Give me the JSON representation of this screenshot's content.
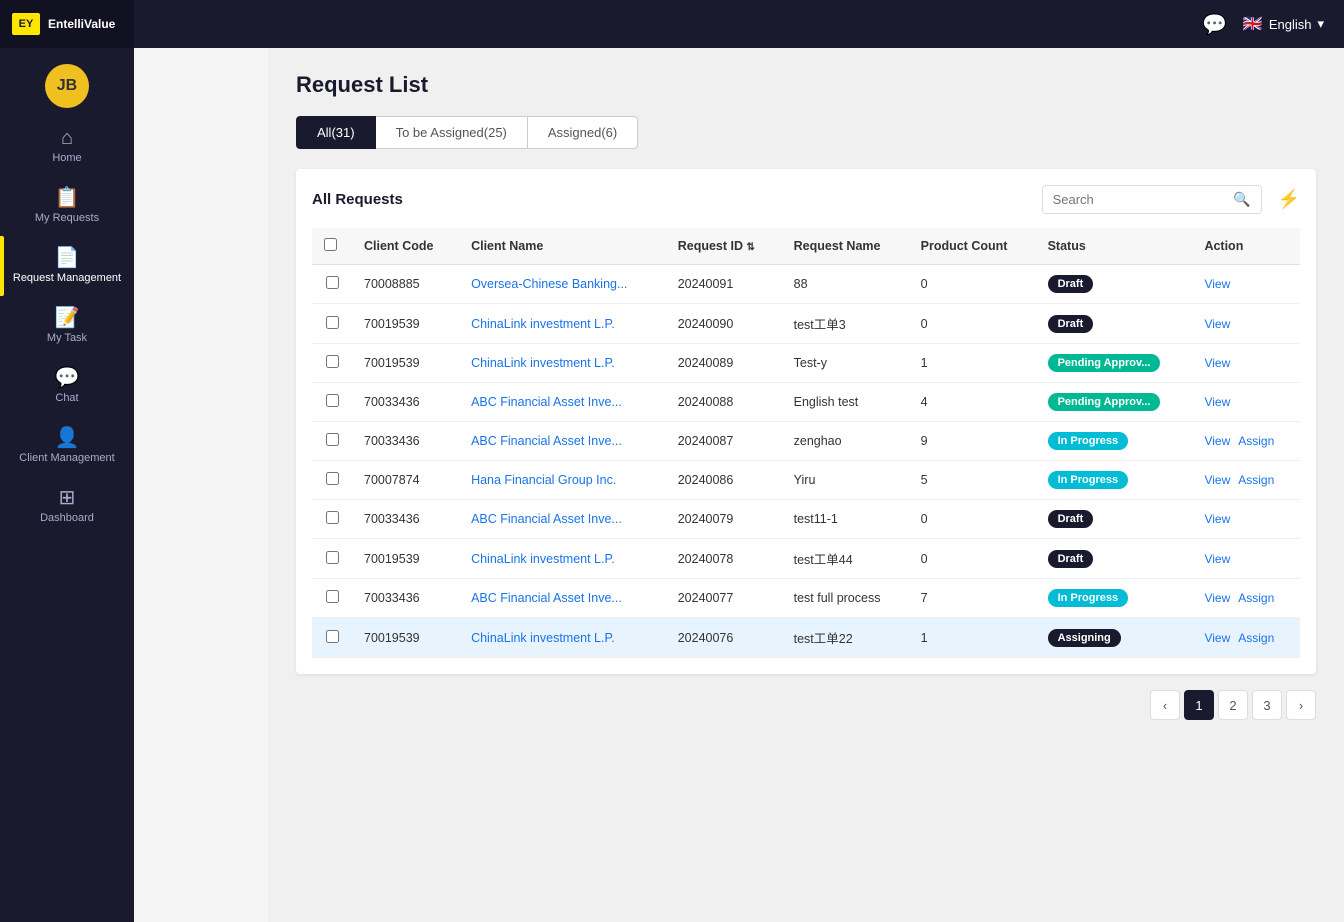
{
  "app": {
    "brand": "EntelliValue",
    "logo_text": "EY"
  },
  "topbar": {
    "language": "English",
    "language_icon": "🇬🇧"
  },
  "sidebar": {
    "avatar_initials": "JB",
    "nav_items": [
      {
        "id": "home",
        "label": "Home",
        "icon": "⌂",
        "active": false
      },
      {
        "id": "my-requests",
        "label": "My Requests",
        "icon": "📋",
        "active": false
      },
      {
        "id": "request-management",
        "label": "Request Management",
        "icon": "📄",
        "active": true
      },
      {
        "id": "my-task",
        "label": "My Task",
        "icon": "📝",
        "active": false
      },
      {
        "id": "chat",
        "label": "Chat",
        "icon": "💬",
        "active": false
      },
      {
        "id": "client-management",
        "label": "Client Management",
        "icon": "👤",
        "active": false
      },
      {
        "id": "dashboard",
        "label": "Dashboard",
        "icon": "⊞",
        "active": false
      }
    ]
  },
  "page": {
    "title": "Request List",
    "tabs": [
      {
        "id": "all",
        "label": "All(31)",
        "active": true
      },
      {
        "id": "to-be-assigned",
        "label": "To be Assigned(25)",
        "active": false
      },
      {
        "id": "assigned",
        "label": "Assigned(6)",
        "active": false
      }
    ],
    "section_title": "All Requests",
    "search_placeholder": "Search"
  },
  "table": {
    "columns": [
      {
        "id": "select",
        "label": ""
      },
      {
        "id": "client-code",
        "label": "Client Code"
      },
      {
        "id": "client-name",
        "label": "Client Name"
      },
      {
        "id": "request-id",
        "label": "Request ID"
      },
      {
        "id": "request-name",
        "label": "Request Name"
      },
      {
        "id": "product-count",
        "label": "Product Count"
      },
      {
        "id": "status",
        "label": "Status"
      },
      {
        "id": "action",
        "label": "Action"
      }
    ],
    "rows": [
      {
        "id": "row-1",
        "client_code": "70008885",
        "client_name": "Oversea-Chinese Banking...",
        "request_id": "20240091",
        "request_name": "88",
        "product_count": "0",
        "status": "Draft",
        "status_type": "draft",
        "actions": [
          "View"
        ],
        "highlighted": false
      },
      {
        "id": "row-2",
        "client_code": "70019539",
        "client_name": "ChinaLink investment L.P.",
        "request_id": "20240090",
        "request_name": "test工单3",
        "product_count": "0",
        "status": "Draft",
        "status_type": "draft",
        "actions": [
          "View"
        ],
        "highlighted": false
      },
      {
        "id": "row-3",
        "client_code": "70019539",
        "client_name": "ChinaLink investment L.P.",
        "request_id": "20240089",
        "request_name": "Test-y",
        "product_count": "1",
        "status": "Pending Approv...",
        "status_type": "pending",
        "actions": [
          "View"
        ],
        "highlighted": false
      },
      {
        "id": "row-4",
        "client_code": "70033436",
        "client_name": "ABC Financial Asset Inve...",
        "request_id": "20240088",
        "request_name": "English test",
        "product_count": "4",
        "status": "Pending Approv...",
        "status_type": "pending",
        "actions": [
          "View"
        ],
        "highlighted": false
      },
      {
        "id": "row-5",
        "client_code": "70033436",
        "client_name": "ABC Financial Asset Inve...",
        "request_id": "20240087",
        "request_name": "zenghao",
        "product_count": "9",
        "status": "In Progress",
        "status_type": "inprogress",
        "actions": [
          "View",
          "Assign"
        ],
        "highlighted": false
      },
      {
        "id": "row-6",
        "client_code": "70007874",
        "client_name": "Hana Financial Group Inc.",
        "request_id": "20240086",
        "request_name": "Yiru",
        "product_count": "5",
        "status": "In Progress",
        "status_type": "inprogress",
        "actions": [
          "View",
          "Assign"
        ],
        "highlighted": false
      },
      {
        "id": "row-7",
        "client_code": "70033436",
        "client_name": "ABC Financial Asset Inve...",
        "request_id": "20240079",
        "request_name": "test11-1",
        "product_count": "0",
        "status": "Draft",
        "status_type": "draft",
        "actions": [
          "View"
        ],
        "highlighted": false
      },
      {
        "id": "row-8",
        "client_code": "70019539",
        "client_name": "ChinaLink investment L.P.",
        "request_id": "20240078",
        "request_name": "test工单44",
        "product_count": "0",
        "status": "Draft",
        "status_type": "draft",
        "actions": [
          "View"
        ],
        "highlighted": false
      },
      {
        "id": "row-9",
        "client_code": "70033436",
        "client_name": "ABC Financial Asset Inve...",
        "request_id": "20240077",
        "request_name": "test full process",
        "product_count": "7",
        "status": "In Progress",
        "status_type": "inprogress",
        "actions": [
          "View",
          "Assign"
        ],
        "highlighted": false
      },
      {
        "id": "row-10",
        "client_code": "70019539",
        "client_name": "ChinaLink investment L.P.",
        "request_id": "20240076",
        "request_name": "test工单22",
        "product_count": "1",
        "status": "Assigning",
        "status_type": "assigning",
        "actions": [
          "View",
          "Assign"
        ],
        "highlighted": true
      }
    ]
  },
  "pagination": {
    "current_page": 1,
    "pages": [
      1,
      2,
      3
    ],
    "prev_label": "‹",
    "next_label": "›"
  }
}
